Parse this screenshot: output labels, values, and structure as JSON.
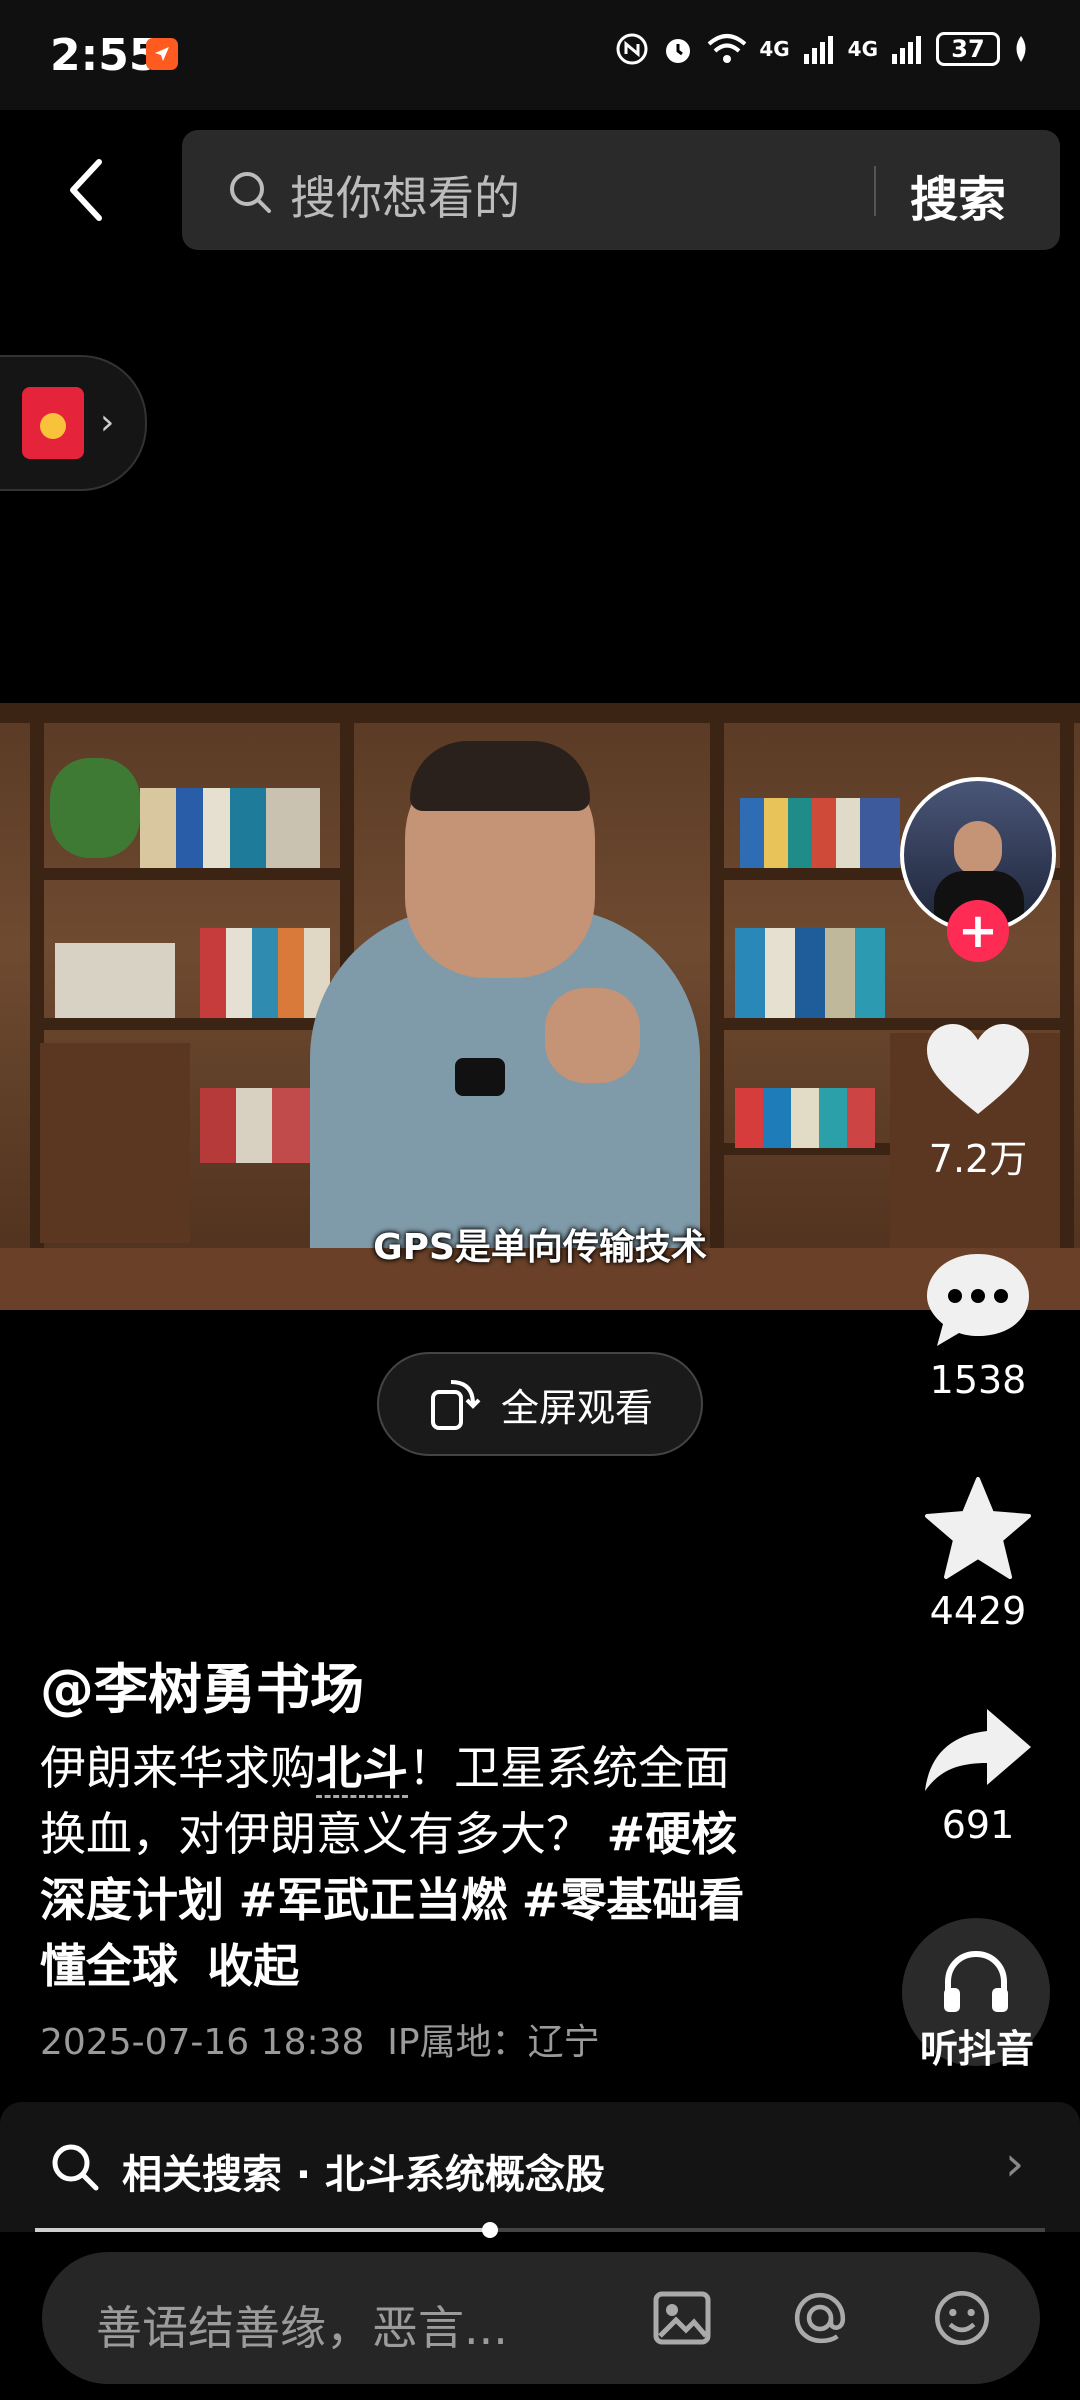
{
  "status_bar": {
    "time": "2:55",
    "network1": "4G",
    "network2": "4G",
    "battery": "37"
  },
  "search": {
    "placeholder": "搜你想看的",
    "button_label": "搜索"
  },
  "video": {
    "subtitle": "GPS是单向传输技术"
  },
  "fullscreen": {
    "label": "全屏观看"
  },
  "actions": {
    "likes": "7.2万",
    "comments": "1538",
    "favorites": "4429",
    "shares": "691",
    "listen_label": "听抖音"
  },
  "post": {
    "author": "@李树勇书场",
    "desc_prefix": "伊朗来华求购",
    "desc_keyword": "北斗",
    "desc_rest": "！卫星系统全面换血，对伊朗意义有多大？ ",
    "hashtags": [
      "#硬核深度计划",
      "#军武正当燃",
      "#零基础看懂全球"
    ],
    "collapse_label": "收起",
    "date": "2025-07-16 18:38",
    "location": "IP属地：辽宁"
  },
  "related_search": {
    "label": "相关搜索 · 北斗系统概念股"
  },
  "playback": {
    "progress": 0.45
  },
  "comment": {
    "placeholder": "善语结善缘，恶言..."
  },
  "colors": {
    "accent": "#fe2c55",
    "background": "#000000"
  }
}
